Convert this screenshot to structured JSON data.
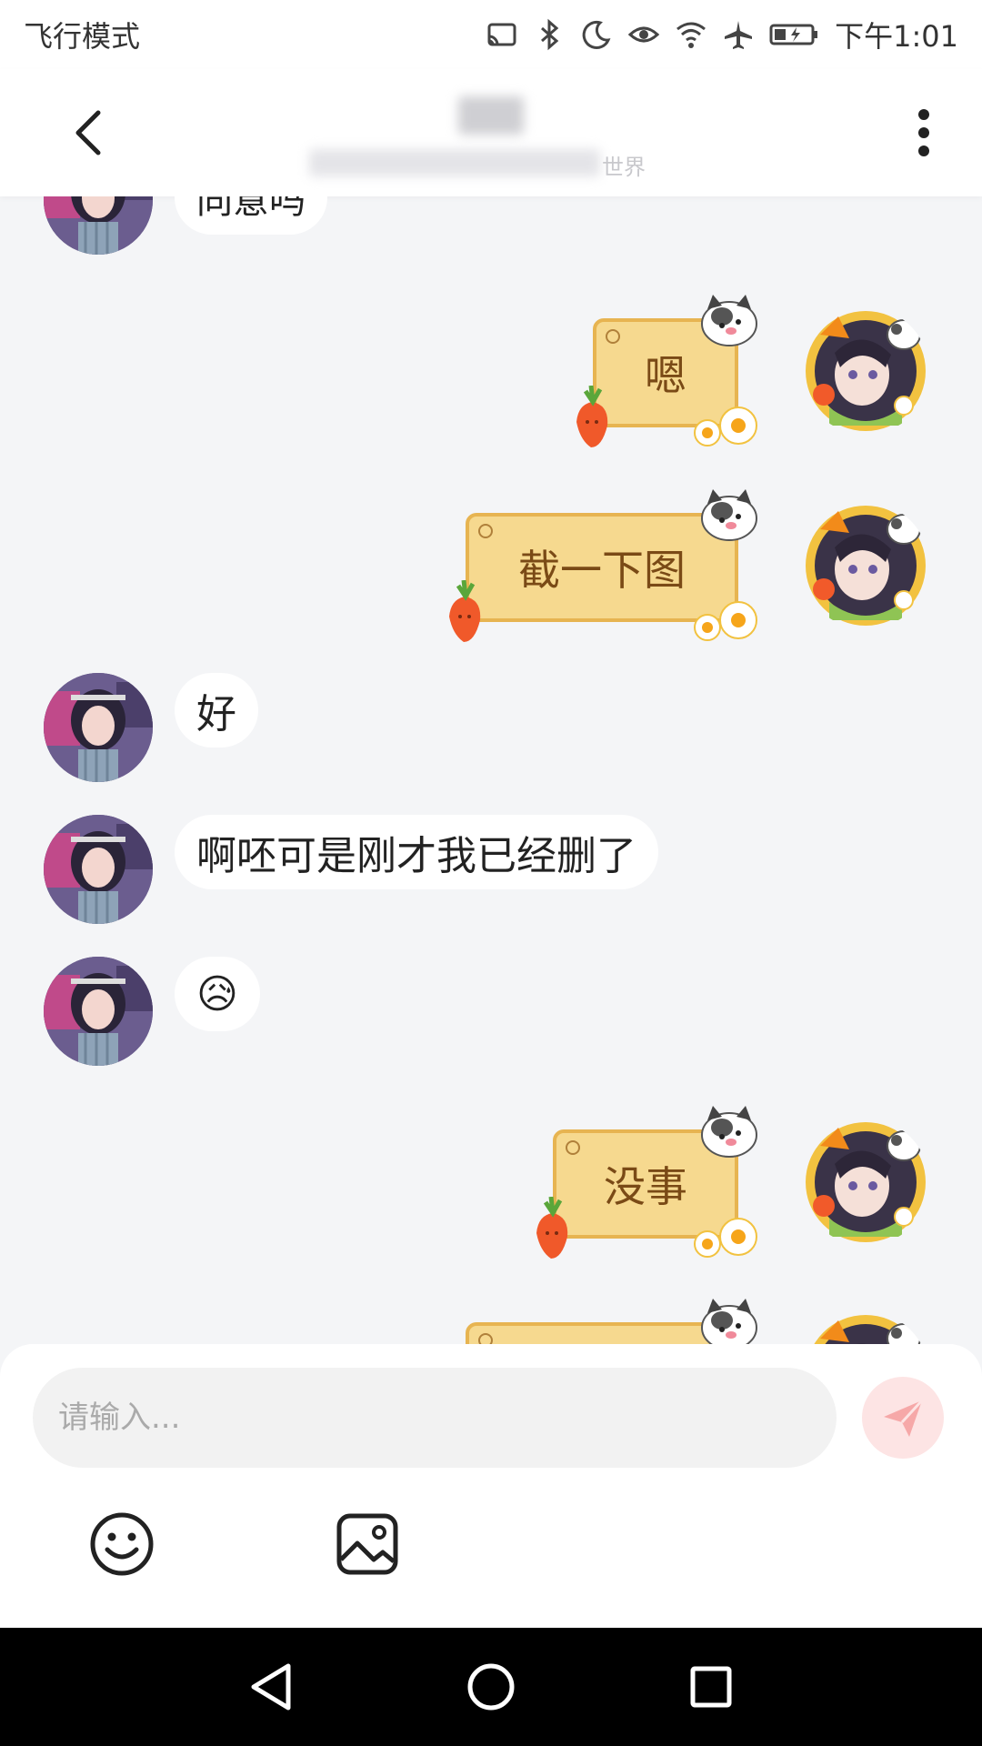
{
  "status_bar": {
    "mode": "飞行模式",
    "time": "下午1:01",
    "icons": [
      "cast-icon",
      "bluetooth-icon",
      "moon-icon",
      "eye-icon",
      "wifi-icon",
      "airplane-icon",
      "battery-icon"
    ]
  },
  "header": {
    "title": "",
    "subtitle_tail": "世界",
    "back_icon": "chevron-left-icon",
    "more_icon": "more-vertical-icon"
  },
  "messages": [
    {
      "side": "left",
      "type": "text",
      "text": "同意吗"
    },
    {
      "side": "right",
      "type": "sticker-bubble",
      "text": "嗯"
    },
    {
      "side": "right",
      "type": "sticker-bubble",
      "text": "截一下图"
    },
    {
      "side": "left",
      "type": "text",
      "text": "好"
    },
    {
      "side": "left",
      "type": "text",
      "text": "啊呸可是刚才我已经删了"
    },
    {
      "side": "left",
      "type": "emoji",
      "text": "😥"
    },
    {
      "side": "right",
      "type": "sticker-bubble",
      "text": "没事"
    },
    {
      "side": "right",
      "type": "sticker-bubble",
      "text": ""
    }
  ],
  "composer": {
    "placeholder": "请输入...",
    "send_icon": "send-icon",
    "tools": [
      "emoji-icon",
      "image-icon"
    ],
    "send_color": "#f08a8a"
  },
  "colors": {
    "background": "#f4f5f7",
    "bubble_left": "#ffffff",
    "sticker_fill": "#f6d98f",
    "sticker_border": "#e7b451",
    "sticker_text": "#7a4a16"
  },
  "nav_bar": {
    "buttons": [
      "back-triangle-icon",
      "home-circle-icon",
      "recents-square-icon"
    ]
  }
}
